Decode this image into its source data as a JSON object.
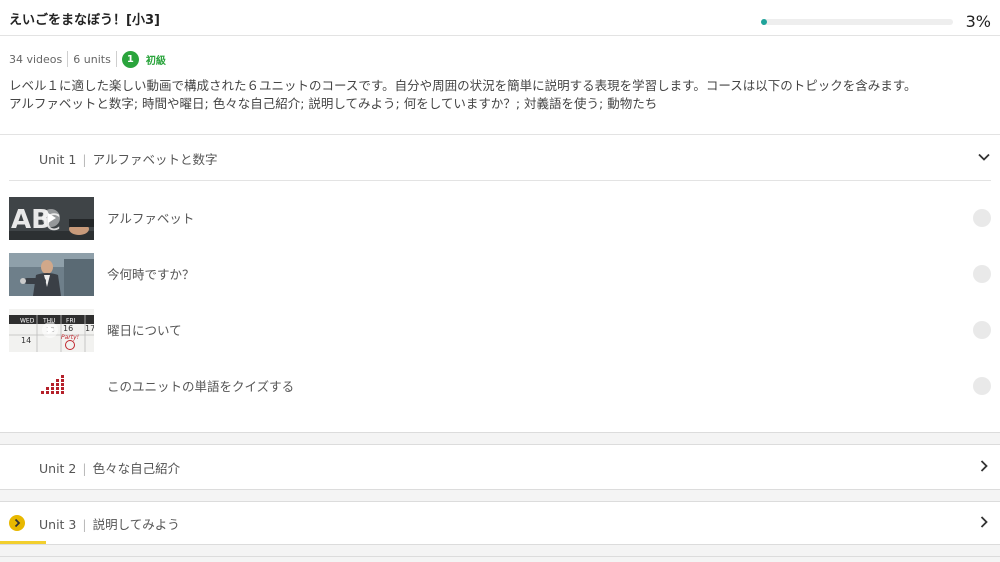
{
  "header": {
    "course_title": "えいごをまなぼう！[小3]",
    "progress_percent": 3,
    "progress_label": "3%"
  },
  "meta": {
    "videos": "34 videos",
    "units": "6 units",
    "level_number": "1",
    "level_label": "初級"
  },
  "description": {
    "line1": "レベル１に適した楽しい動画で構成された６ユニットのコースです。自分や周囲の状況を簡単に説明する表現を学習します。コースは以下のトピックを含みます。",
    "line2": "アルファベットと数字; 時間や曜日; 色々な自己紹介; 説明してみよう; 何をしていますか？; 対義語を使う; 動物たち"
  },
  "units": [
    {
      "number": "Unit 1",
      "name": "アルファベットと数字",
      "expanded": true,
      "lessons": [
        {
          "label": "アルファベット",
          "thumb_icon": "abc-chalkboard-thumbnail"
        },
        {
          "label": "今何時ですか？",
          "thumb_icon": "man-watch-thumbnail"
        },
        {
          "label": "曜日について",
          "thumb_icon": "calendar-thumbnail",
          "thumb_text": [
            "WED",
            "THU",
            "FRI",
            "15",
            "16",
            "17",
            "14",
            "Party!"
          ]
        },
        {
          "label": "このユニットの単語をクイズする",
          "thumb_icon": "quiz-bars-icon"
        }
      ]
    },
    {
      "number": "Unit 2",
      "name": "色々な自己紹介",
      "expanded": false
    },
    {
      "number": "Unit 3",
      "name": "説明してみよう",
      "expanded": false,
      "current": true
    }
  ],
  "colors": {
    "progress_fill": "#1fa39a",
    "level_green": "#2aa43c",
    "current_badge": "#e8b800",
    "quiz_red": "#b5202a"
  }
}
